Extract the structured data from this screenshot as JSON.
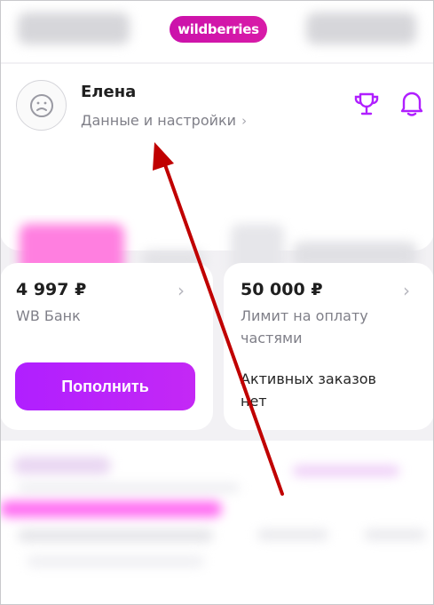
{
  "header": {
    "logo_text": "wildberries"
  },
  "profile": {
    "name": "Елена",
    "settings_link": "Данные и настройки",
    "icons": [
      "user-icon",
      "trophy-icon",
      "bell-icon",
      "chevron-right-icon"
    ]
  },
  "wallet": {
    "bank": {
      "amount": "4 997 ₽",
      "label": "WB Банк",
      "button_label": "Пополнить"
    },
    "installment": {
      "amount": "50 000 ₽",
      "label_line1": "Лимит на оплату",
      "label_line2": "частями",
      "orders_line1": "Активных заказов",
      "orders_line2": "нет"
    }
  },
  "colors": {
    "brand": "#cb11ab",
    "accent": "#b01fff",
    "annotation_arrow": "#c00000"
  }
}
